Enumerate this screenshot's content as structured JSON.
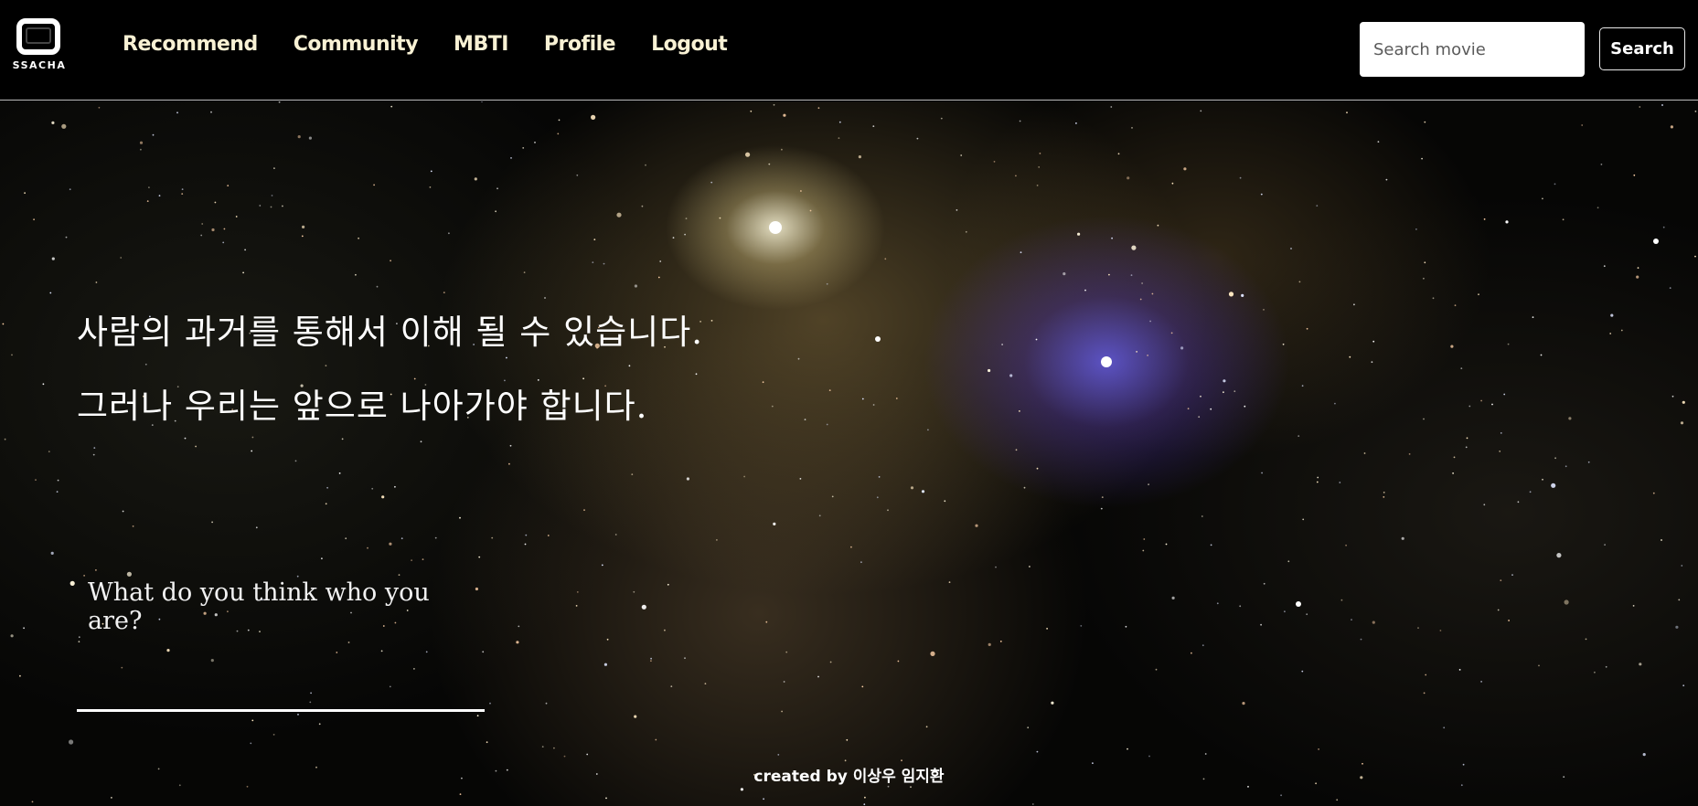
{
  "header": {
    "logo_text": "SSACHA",
    "nav": [
      {
        "label": "Recommend"
      },
      {
        "label": "Community"
      },
      {
        "label": "MBTI"
      },
      {
        "label": "Profile"
      },
      {
        "label": "Logout"
      }
    ],
    "search": {
      "placeholder": "Search movie",
      "value": "",
      "button_label": "Search"
    }
  },
  "hero": {
    "headline_1": "사람의 과거를 통해서 이해 될 수 있습니다.",
    "headline_2": "그러나 우리는 앞으로 나아가야 합니다.",
    "question": {
      "placeholder": "What do you think who you are?",
      "value": ""
    }
  },
  "footer": {
    "credit": "created by 이상우 임지환"
  },
  "colors": {
    "nav_text": "#f8f1d4",
    "header_bg": "#000000",
    "header_border": "#bdbdbd",
    "text_white": "#ffffff"
  }
}
